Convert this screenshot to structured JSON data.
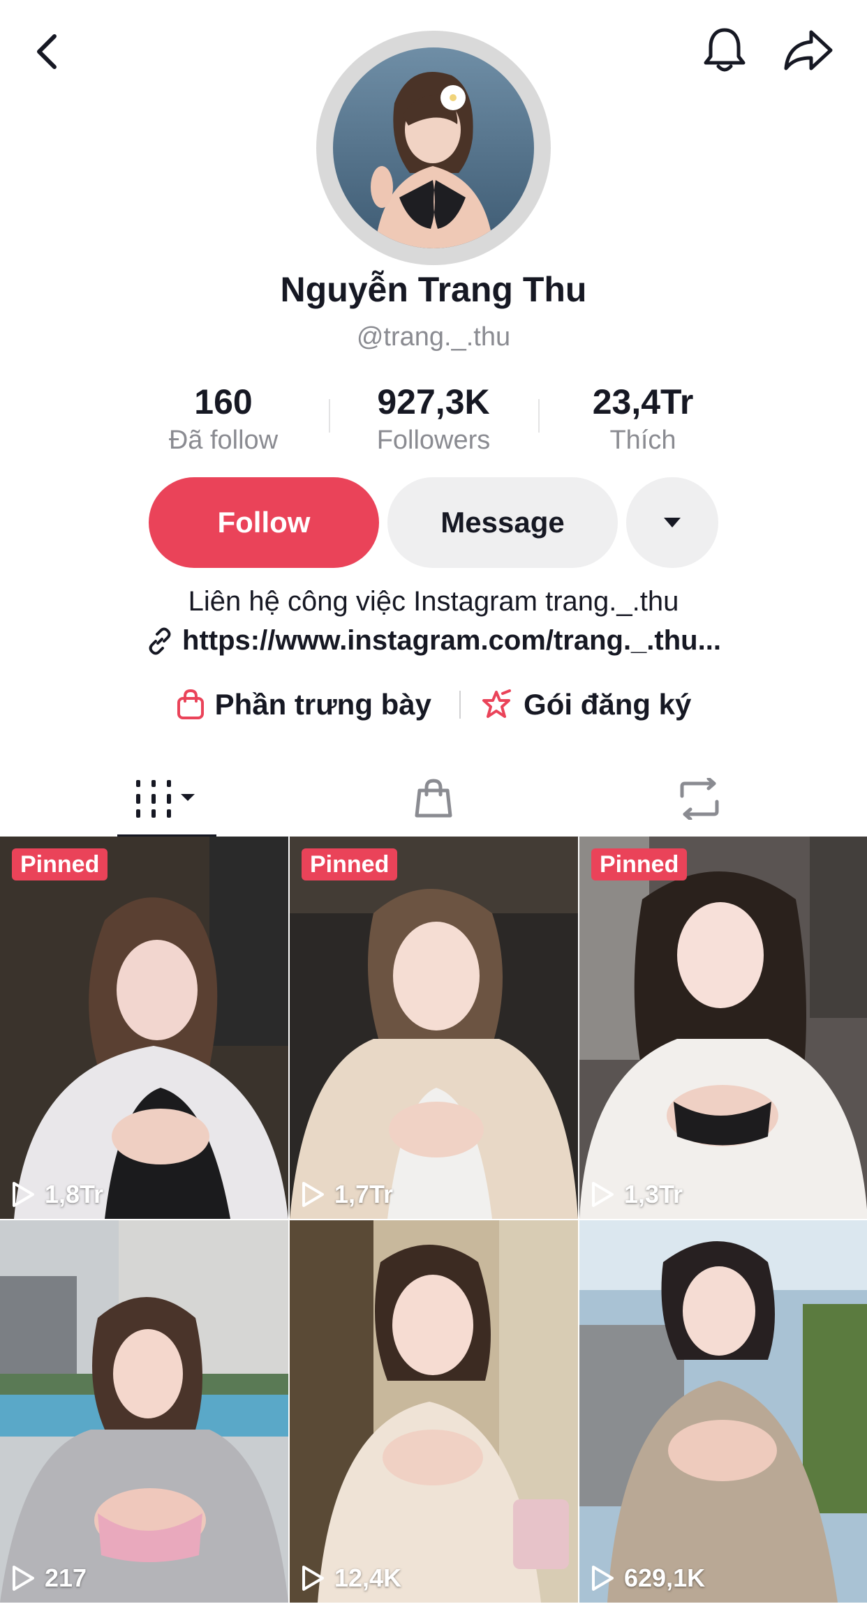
{
  "profile": {
    "name": "Nguyễn Trang Thu",
    "handle": "@trang._.thu"
  },
  "stats": [
    {
      "value": "160",
      "label": "Đã follow"
    },
    {
      "value": "927,3K",
      "label": "Followers"
    },
    {
      "value": "23,4Tr",
      "label": "Thích"
    }
  ],
  "actions": {
    "follow_label": "Follow",
    "message_label": "Message"
  },
  "bio": {
    "text": "Liên hệ công việc Instagram trang._.thu",
    "link": "https://www.instagram.com/trang._.thu..."
  },
  "features": {
    "showcase_label": "Phần trưng bày",
    "subscription_label": "Gói đăng ký"
  },
  "tabs": [
    {
      "icon": "videos-grid-icon",
      "active": true
    },
    {
      "icon": "shopping-bag-icon",
      "active": false
    },
    {
      "icon": "repost-icon",
      "active": false
    }
  ],
  "videos": [
    {
      "pinned_label": "Pinned",
      "views": "1,8Tr"
    },
    {
      "pinned_label": "Pinned",
      "views": "1,7Tr"
    },
    {
      "pinned_label": "Pinned",
      "views": "1,3Tr"
    },
    {
      "pinned_label": "",
      "views": "217"
    },
    {
      "pinned_label": "",
      "views": "12,4K"
    },
    {
      "pinned_label": "",
      "views": "629,1K"
    }
  ],
  "colors": {
    "accent": "#ea4359",
    "text": "#161823",
    "muted": "#8a8b91",
    "button_bg": "#efeff0"
  }
}
